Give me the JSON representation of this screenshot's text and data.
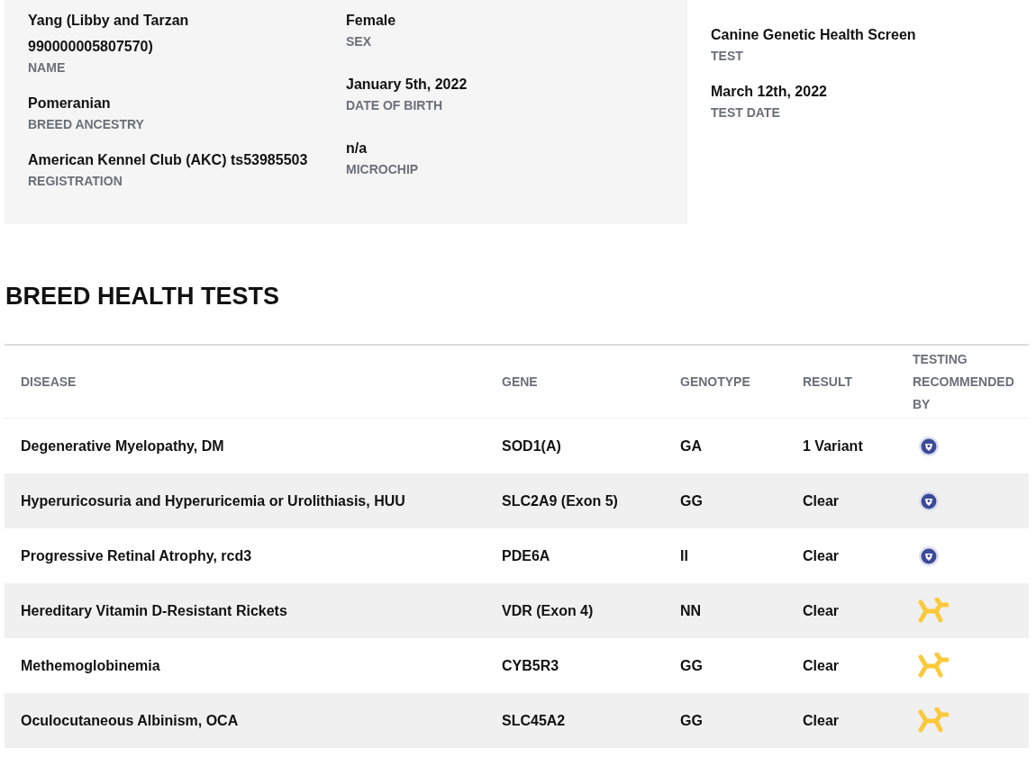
{
  "profile": {
    "columns": [
      [
        {
          "value": "Yang (Libby and Tarzan 990000005807570)",
          "label": "NAME"
        },
        {
          "value": "Pomeranian",
          "label": "BREED ANCESTRY"
        },
        {
          "value": "American Kennel Club (AKC) ts53985503",
          "label": "REGISTRATION"
        }
      ],
      [
        {
          "value": "Female",
          "label": "SEX"
        },
        {
          "value": "January 5th, 2022",
          "label": "DATE OF BIRTH"
        },
        {
          "value": "n/a",
          "label": "MICROCHIP"
        }
      ]
    ]
  },
  "test_info": [
    {
      "value": "Canine Genetic Health Screen",
      "label": "TEST"
    },
    {
      "value": "March 12th, 2022",
      "label": "TEST DATE"
    }
  ],
  "section_title": "BREED HEALTH TESTS",
  "table": {
    "columns": [
      "DISEASE",
      "GENE",
      "GENOTYPE",
      "RESULT",
      "TESTING RECOMMENDED BY"
    ],
    "rows": [
      {
        "disease": "Degenerative Myelopathy, DM",
        "gene": "SOD1(A)",
        "genotype": "GA",
        "result": "1 Variant",
        "recommended_by": {
          "kind": "badge"
        }
      },
      {
        "disease": "Hyperuricosuria and Hyperuricemia or Urolithiasis, HUU",
        "gene": "SLC2A9 (Exon 5)",
        "genotype": "GG",
        "result": "Clear",
        "recommended_by": {
          "kind": "badge"
        }
      },
      {
        "disease": "Progressive Retinal Atrophy, rcd3",
        "gene": "PDE6A",
        "genotype": "II",
        "result": "Clear",
        "recommended_by": {
          "kind": "badge"
        }
      },
      {
        "disease": "Hereditary Vitamin D-Resistant Rickets",
        "gene": "VDR (Exon 4)",
        "genotype": "NN",
        "result": "Clear",
        "recommended_by": {
          "kind": "molecule"
        }
      },
      {
        "disease": "Methemoglobinemia",
        "gene": "CYB5R3",
        "genotype": "GG",
        "result": "Clear",
        "recommended_by": {
          "kind": "molecule"
        }
      },
      {
        "disease": "Oculocutaneous Albinism, OCA",
        "gene": "SLC45A2",
        "genotype": "GG",
        "result": "Clear",
        "recommended_by": {
          "kind": "molecule"
        }
      }
    ]
  }
}
